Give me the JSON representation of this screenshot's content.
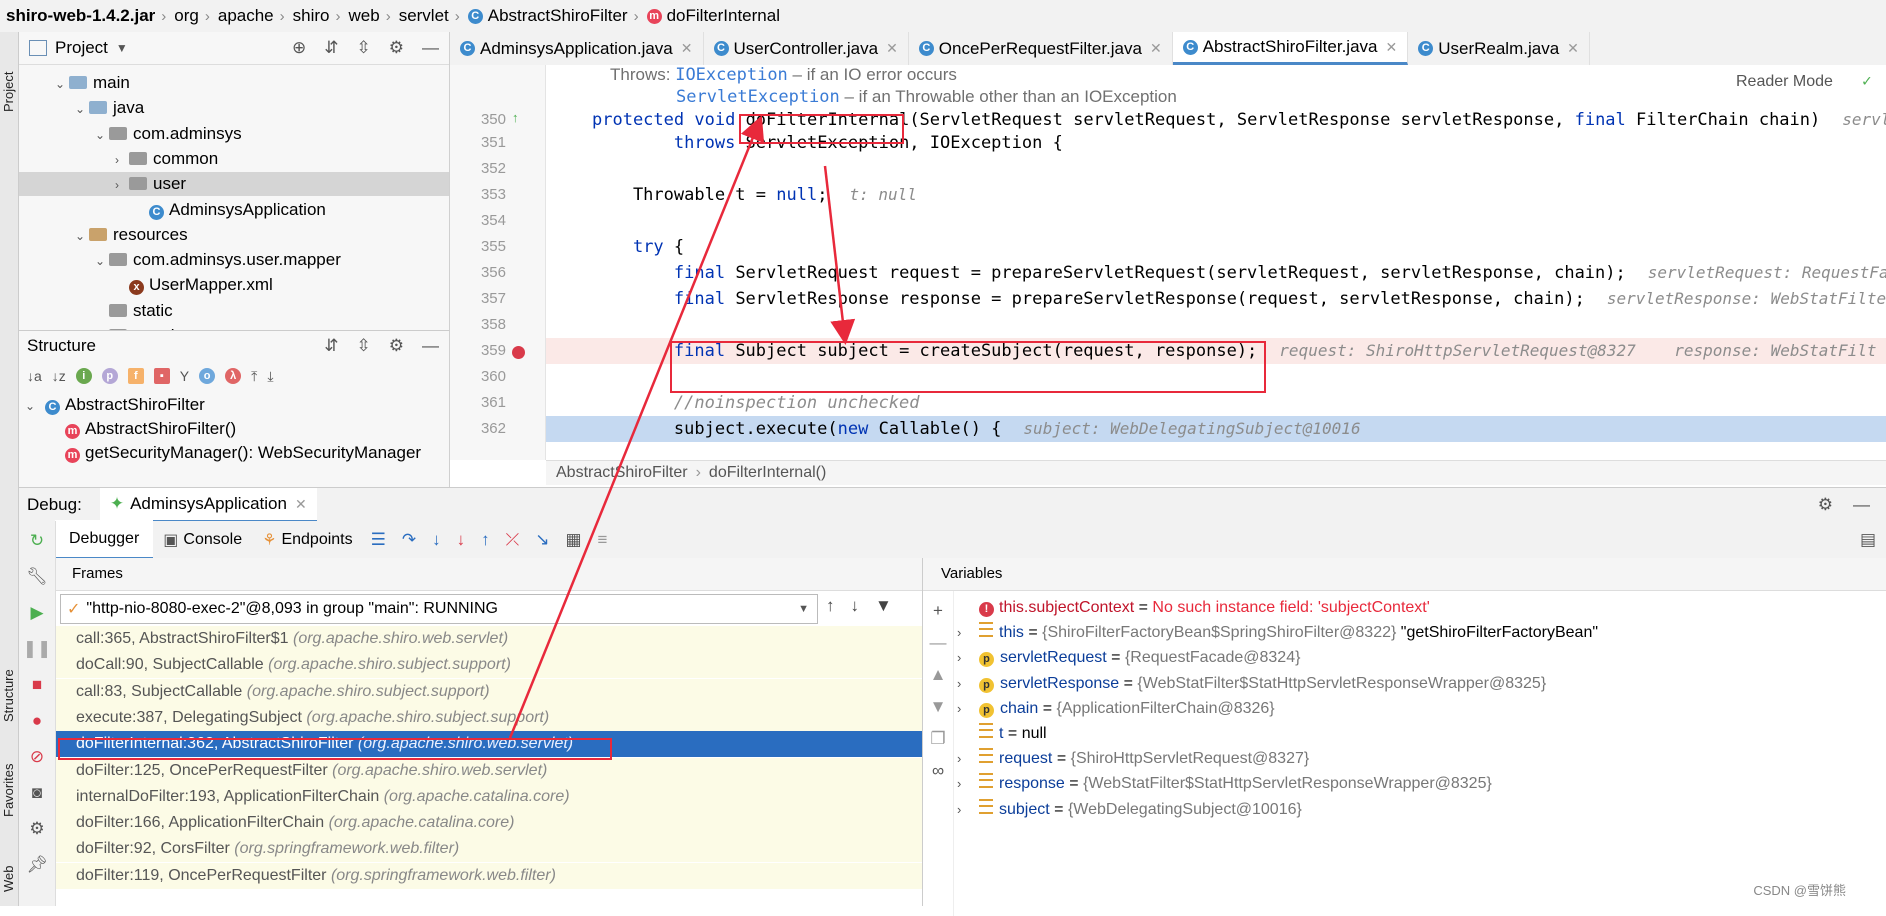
{
  "breadcrumb": {
    "items": [
      "shiro-web-1.4.2.jar",
      "org",
      "apache",
      "shiro",
      "web",
      "servlet",
      "AbstractShiroFilter",
      "doFilterInternal"
    ]
  },
  "side_stripe": {
    "project": "Project",
    "structure": "Structure",
    "favorites": "Favorites",
    "web": "Web"
  },
  "project_panel": {
    "title": "Project",
    "tree": [
      {
        "label": "main",
        "indent": 2,
        "kind": "folder",
        "open": true
      },
      {
        "label": "java",
        "indent": 3,
        "kind": "folder",
        "open": true
      },
      {
        "label": "com.adminsys",
        "indent": 4,
        "kind": "pkg",
        "open": true
      },
      {
        "label": "common",
        "indent": 5,
        "kind": "pkg",
        "open": false
      },
      {
        "label": "user",
        "indent": 5,
        "kind": "pkg",
        "open": false,
        "selected": true
      },
      {
        "label": "AdminsysApplication",
        "indent": 6,
        "kind": "class"
      },
      {
        "label": "resources",
        "indent": 3,
        "kind": "res",
        "open": true
      },
      {
        "label": "com.adminsys.user.mapper",
        "indent": 4,
        "kind": "pkg",
        "open": true
      },
      {
        "label": "UserMapper.xml",
        "indent": 5,
        "kind": "xml"
      },
      {
        "label": "static",
        "indent": 4,
        "kind": "pkg"
      },
      {
        "label": "templates",
        "indent": 4,
        "kind": "pkg"
      }
    ]
  },
  "structure_panel": {
    "title": "Structure",
    "root": "AbstractShiroFilter",
    "members": [
      "AbstractShiroFilter()",
      "getSecurityManager(): WebSecurityManager"
    ]
  },
  "editor": {
    "tabs": [
      {
        "label": "AdminsysApplication.java",
        "active": false
      },
      {
        "label": "UserController.java",
        "active": false
      },
      {
        "label": "OncePerRequestFilter.java",
        "active": false
      },
      {
        "label": "AbstractShiroFilter.java",
        "active": true
      },
      {
        "label": "UserRealm.java",
        "active": false
      }
    ],
    "reader_mode": "Reader Mode",
    "doc_throws_label": "Throws:",
    "doc_line1_type": "IOException",
    "doc_line1_text": " – if an IO error occurs",
    "doc_line2_type": "ServletException",
    "doc_line2_text": " – if an Throwable other than an IOException",
    "lines": [
      {
        "num": "350",
        "code": "protected void doFilterInternal(ServletRequest servletRequest, ServletResponse servletResponse, final FilterChain chain)",
        "hint": "servlet"
      },
      {
        "num": "351",
        "code": "        throws ServletException, IOException {",
        "hint": ""
      },
      {
        "num": "352",
        "code": "",
        "hint": ""
      },
      {
        "num": "353",
        "code": "    Throwable t = null;",
        "hint": "t: null"
      },
      {
        "num": "354",
        "code": "",
        "hint": ""
      },
      {
        "num": "355",
        "code": "    try {",
        "hint": ""
      },
      {
        "num": "356",
        "code": "        final ServletRequest request = prepareServletRequest(servletRequest, servletResponse, chain);",
        "hint": "servletRequest: RequestFac"
      },
      {
        "num": "357",
        "code": "        final ServletResponse response = prepareServletResponse(request, servletResponse, chain);",
        "hint": "servletResponse: WebStatFilter"
      },
      {
        "num": "358",
        "code": "",
        "hint": ""
      },
      {
        "num": "359",
        "code": "        final Subject subject = createSubject(request, response);",
        "hint": "request: ShiroHttpServletRequest@8327    response: WebStatFilt"
      },
      {
        "num": "360",
        "code": "",
        "hint": ""
      },
      {
        "num": "361",
        "code": "        //noinspection unchecked",
        "hint": ""
      },
      {
        "num": "362",
        "code": "        subject.execute(new Callable() {",
        "hint": "subject: WebDelegatingSubject@10016"
      }
    ],
    "status_crumb": [
      "AbstractShiroFilter",
      "doFilterInternal()"
    ]
  },
  "debug": {
    "label": "Debug:",
    "session": "AdminsysApplication",
    "tabs": [
      "Debugger",
      "Console",
      "Endpoints"
    ],
    "frames_title": "Frames",
    "variables_title": "Variables",
    "thread": "\"http-nio-8080-exec-2\"@8,093 in group \"main\": RUNNING",
    "frames": [
      {
        "method": "call:365, AbstractShiroFilter$1",
        "pkg": "(org.apache.shiro.web.servlet)"
      },
      {
        "method": "doCall:90, SubjectCallable",
        "pkg": "(org.apache.shiro.subject.support)"
      },
      {
        "method": "call:83, SubjectCallable",
        "pkg": "(org.apache.shiro.subject.support)"
      },
      {
        "method": "execute:387, DelegatingSubject",
        "pkg": "(org.apache.shiro.subject.support)"
      },
      {
        "method": "doFilterInternal:362, AbstractShiroFilter",
        "pkg": "(org.apache.shiro.web.servlet)",
        "selected": true
      },
      {
        "method": "doFilter:125, OncePerRequestFilter",
        "pkg": "(org.apache.shiro.web.servlet)"
      },
      {
        "method": "internalDoFilter:193, ApplicationFilterChain",
        "pkg": "(org.apache.catalina.core)"
      },
      {
        "method": "doFilter:166, ApplicationFilterChain",
        "pkg": "(org.apache.catalina.core)"
      },
      {
        "method": "doFilter:92, CorsFilter",
        "pkg": "(org.springframework.web.filter)"
      },
      {
        "method": "doFilter:119, OncePerRequestFilter",
        "pkg": "(org.springframework.web.filter)"
      }
    ],
    "variables": [
      {
        "kind": "error",
        "name": "this.subjectContext",
        "value": "No such instance field: 'subjectContext'"
      },
      {
        "kind": "field",
        "name": "this",
        "value": "{ShiroFilterFactoryBean$SpringShiroFilter@8322}",
        "extra": "\"getShiroFilterFactoryBean\"",
        "expand": true
      },
      {
        "kind": "param",
        "name": "servletRequest",
        "value": "{RequestFacade@8324}",
        "expand": true
      },
      {
        "kind": "param",
        "name": "servletResponse",
        "value": "{WebStatFilter$StatHttpServletResponseWrapper@8325}",
        "expand": true
      },
      {
        "kind": "param",
        "name": "chain",
        "value": "{ApplicationFilterChain@8326}",
        "expand": true
      },
      {
        "kind": "field",
        "name": "t",
        "value": "null",
        "expand": false
      },
      {
        "kind": "field",
        "name": "request",
        "value": "{ShiroHttpServletRequest@8327}",
        "expand": true
      },
      {
        "kind": "field",
        "name": "response",
        "value": "{WebStatFilter$StatHttpServletResponseWrapper@8325}",
        "expand": true
      },
      {
        "kind": "field",
        "name": "subject",
        "value": "{WebDelegatingSubject@10016}",
        "expand": true
      }
    ]
  },
  "watermark": "CSDN @雪饼熊",
  "colors": {
    "annotation": "#e8293b",
    "selection": "#2a6dc0",
    "breakpoint": "#d93a4a"
  }
}
